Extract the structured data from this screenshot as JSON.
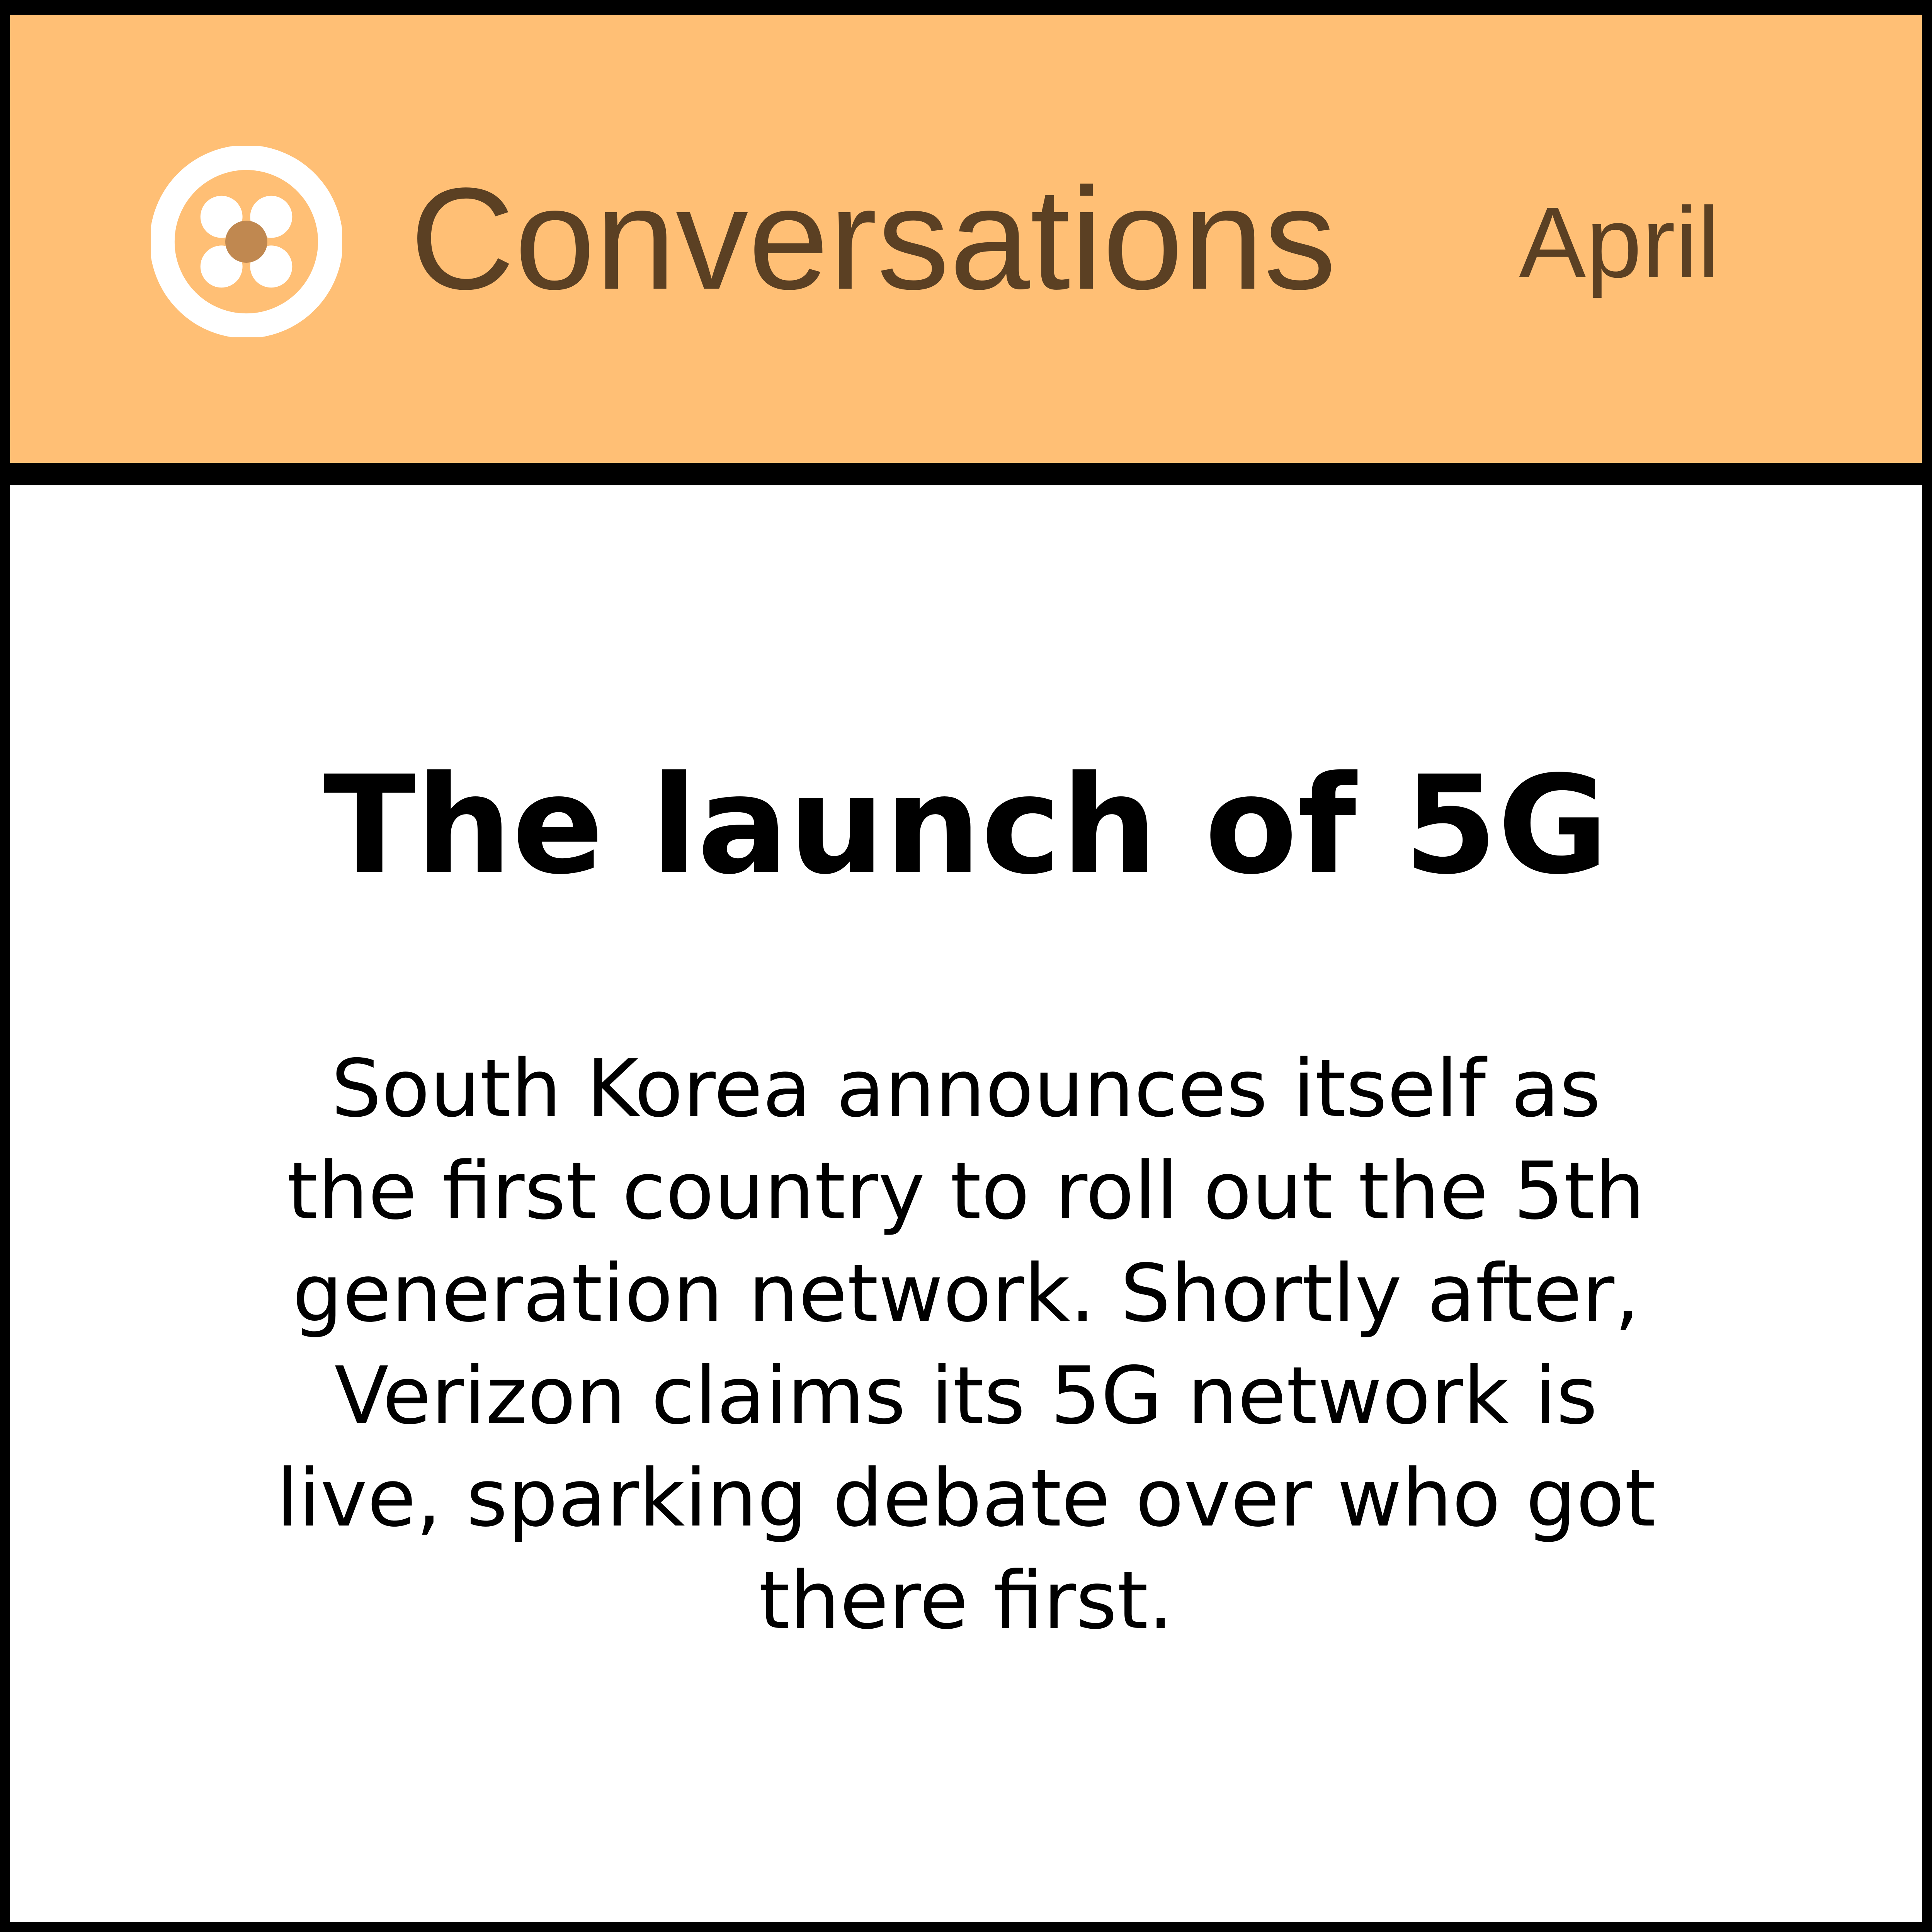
{
  "header": {
    "logo_icon": "conversation-flower-icon",
    "title": "Conversations",
    "month": "April",
    "background_color": "#FFBF75",
    "text_color": "#5B4023"
  },
  "main": {
    "headline": "The launch of 5G",
    "description_lines": [
      "South Korea announces itself as",
      "the first country to roll out the 5th",
      "generation network. Shortly after,",
      "Verizon claims its 5G network is",
      "live, sparking debate over who got",
      "there first."
    ]
  },
  "colors": {
    "border": "#000000",
    "panel": "#FFFFFF",
    "logo_center": "#C08850"
  }
}
